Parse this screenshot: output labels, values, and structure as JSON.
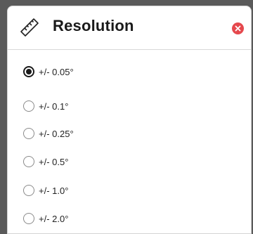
{
  "dialog": {
    "title": "Resolution",
    "icon": "ruler-icon",
    "close_icon": "close-icon",
    "accent_color": "#e5484d"
  },
  "options": [
    {
      "label": "+/- 0.05°",
      "checked": true
    },
    {
      "label": "+/- 0.1°",
      "checked": false
    },
    {
      "label": "+/- 0.25°",
      "checked": false
    },
    {
      "label": "+/- 0.5°",
      "checked": false
    },
    {
      "label": "+/- 1.0°",
      "checked": false
    },
    {
      "label": "+/- 2.0°",
      "checked": false
    }
  ]
}
